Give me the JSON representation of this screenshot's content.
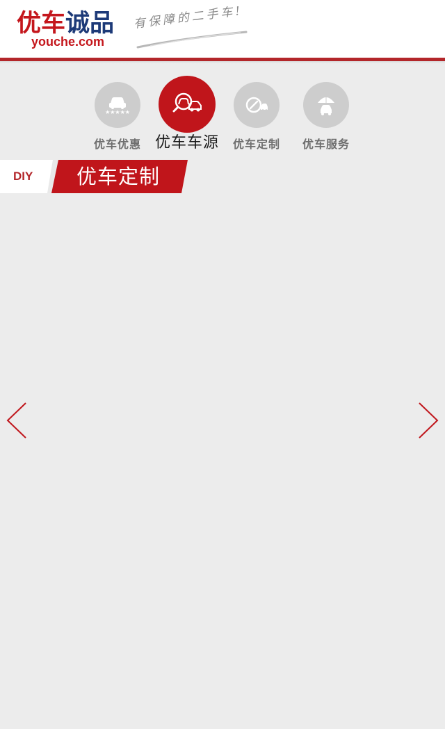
{
  "header": {
    "logo_part1": "优车",
    "logo_part2": "诚品",
    "logo_domain": "youche.com",
    "slogan": "有保障的二手车!"
  },
  "nav": {
    "items": [
      {
        "label": "优车优惠",
        "icon": "car-rating-icon",
        "active": false
      },
      {
        "label": "优车车源",
        "icon": "car-search-icon",
        "active": true
      },
      {
        "label": "优车定制",
        "icon": "car-customize-icon",
        "active": false
      },
      {
        "label": "优车服务",
        "icon": "car-service-icon",
        "active": false
      }
    ]
  },
  "section": {
    "tag": "DIY",
    "title": "优车定制"
  },
  "carousel": {
    "prev_icon": "chevron-left-icon",
    "next_icon": "chevron-right-icon"
  },
  "colors": {
    "brand_red": "#c0151b",
    "brand_blue": "#1d3a78",
    "inactive_icon": "#cdcdcd",
    "background": "#ececec"
  }
}
